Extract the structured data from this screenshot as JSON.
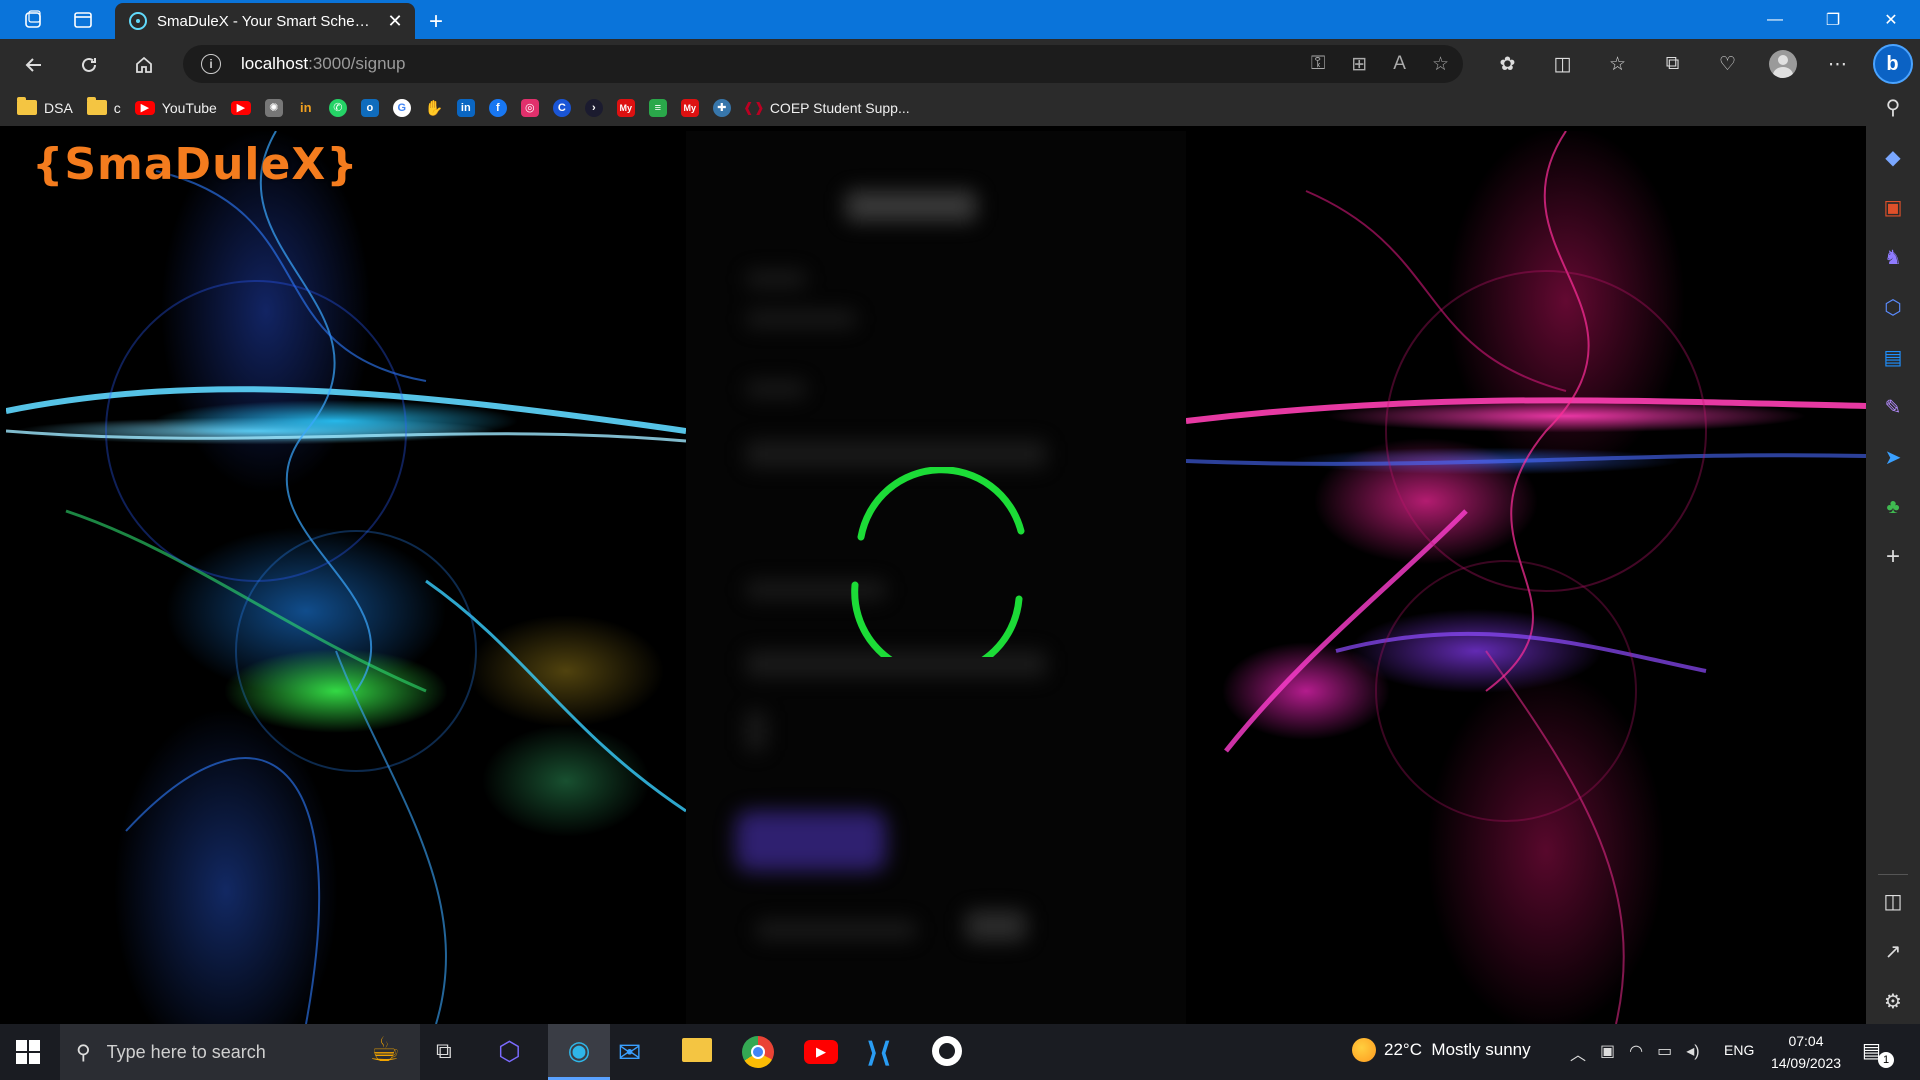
{
  "browser": {
    "tab": {
      "title": "SmaDuleX - Your Smart Scheduling"
    },
    "address": {
      "host": "localhost",
      "path": ":3000/signup"
    },
    "bookmarks": [
      {
        "label": "DSA",
        "icon": "folder-icon"
      },
      {
        "label": "c",
        "icon": "folder-icon"
      },
      {
        "label": "YouTube",
        "icon": "youtube-icon"
      },
      {
        "label": "COEP Student Supp...",
        "icon": "coep-icon"
      }
    ]
  },
  "page": {
    "logo": "{SmaDuleX}",
    "loading_state": "spinner",
    "spinner_color": "#1ee83a",
    "logo_color": "#f47c1e"
  },
  "taskbar": {
    "search_placeholder": "Type here to search",
    "weather": "22°C  Mostly sunny",
    "language": "ENG",
    "time": "07:04",
    "date": "14/09/2023",
    "notifications": "1"
  }
}
